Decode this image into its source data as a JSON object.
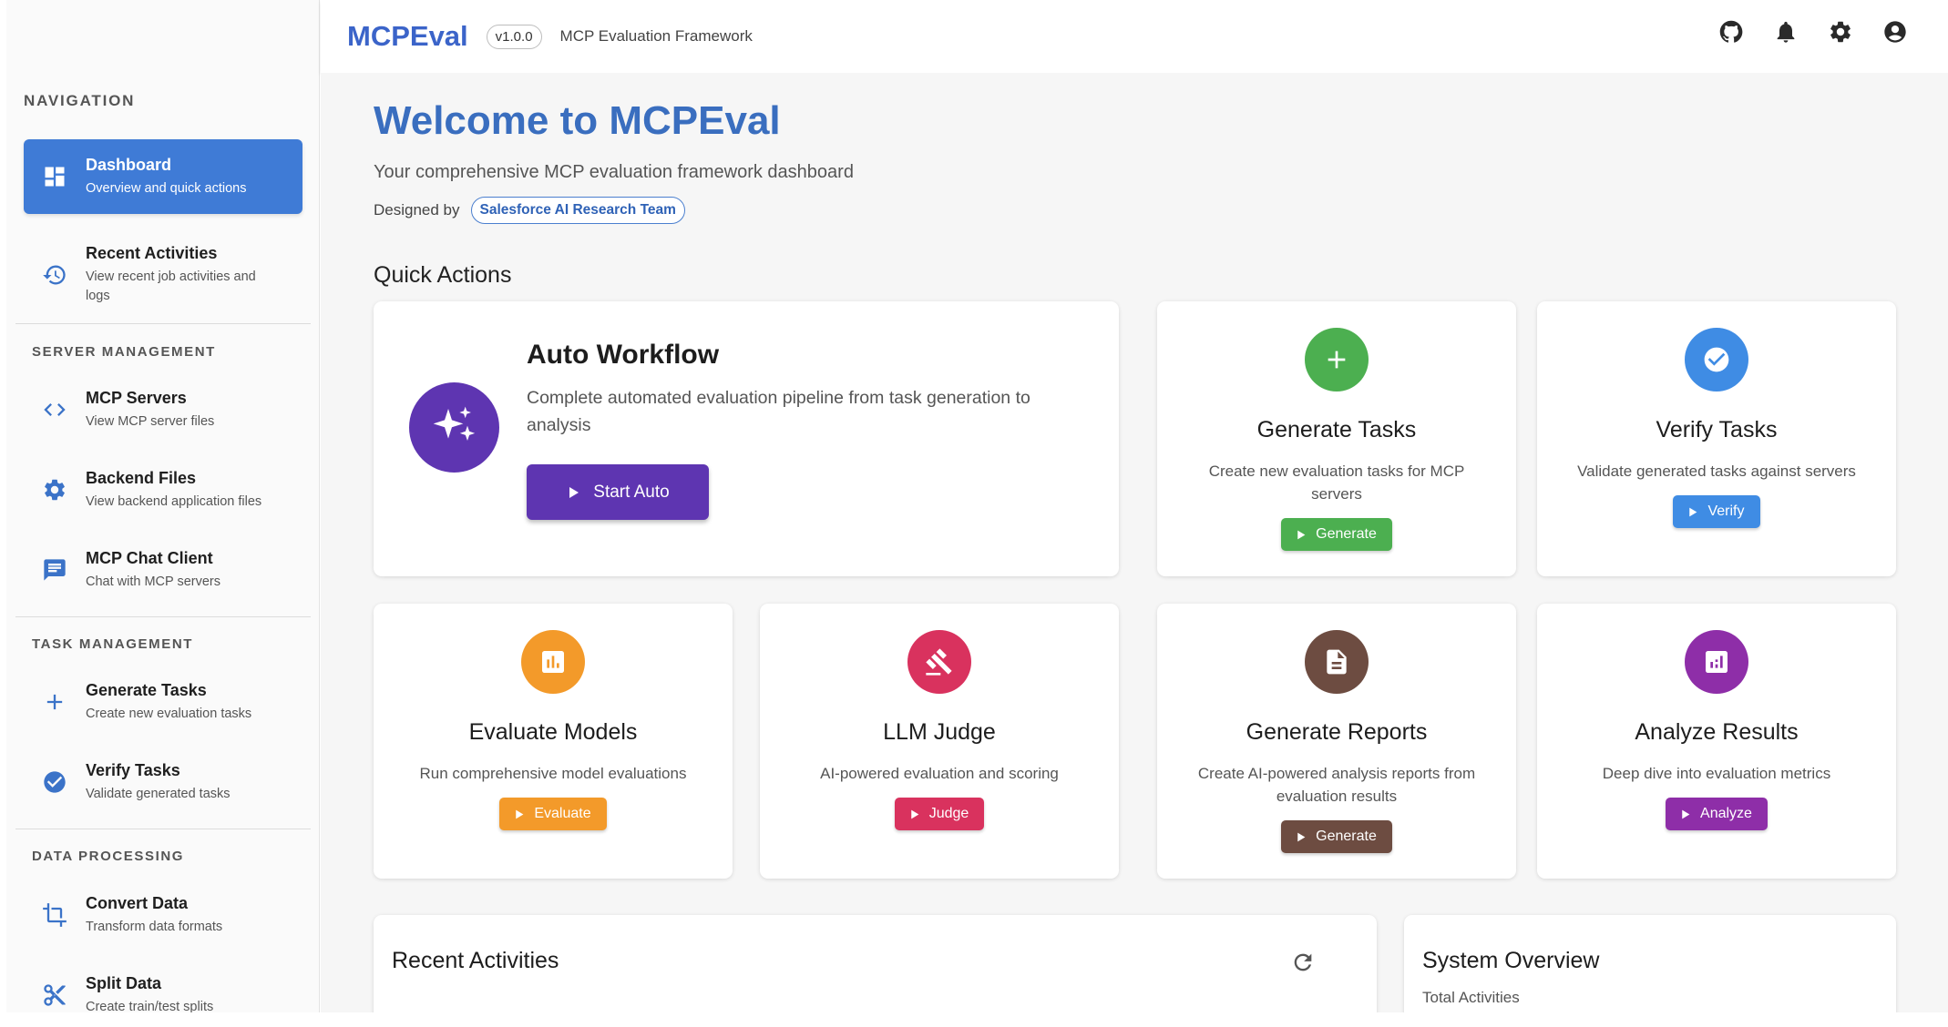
{
  "header": {
    "brand": "MCPEval",
    "version": "v1.0.0",
    "subtitle": "MCP Evaluation Framework",
    "icons": [
      "github-icon",
      "notifications-icon",
      "settings-icon",
      "account-icon"
    ]
  },
  "sidebar": {
    "heading": "NAVIGATION",
    "sections": {
      "server": "SERVER MANAGEMENT",
      "task": "TASK MANAGEMENT",
      "data": "DATA PROCESSING"
    },
    "items": [
      {
        "label": "Dashboard",
        "sub": "Overview and quick actions",
        "icon": "dashboard-icon"
      },
      {
        "label": "Recent Activities",
        "sub": "View recent job activities and logs",
        "icon": "history-icon"
      },
      {
        "label": "MCP Servers",
        "sub": "View MCP server files",
        "icon": "code-icon"
      },
      {
        "label": "Backend Files",
        "sub": "View backend application files",
        "icon": "gear-icon"
      },
      {
        "label": "MCP Chat Client",
        "sub": "Chat with MCP servers",
        "icon": "chat-icon"
      },
      {
        "label": "Generate Tasks",
        "sub": "Create new evaluation tasks",
        "icon": "plus-icon"
      },
      {
        "label": "Verify Tasks",
        "sub": "Validate generated tasks",
        "icon": "check-circle-icon"
      },
      {
        "label": "Convert Data",
        "sub": "Transform data formats",
        "icon": "crop-icon"
      },
      {
        "label": "Split Data",
        "sub": "Create train/test splits",
        "icon": "scissors-icon"
      }
    ]
  },
  "main": {
    "welcome": "Welcome to MCPEval",
    "subtitle": "Your comprehensive MCP evaluation framework dashboard",
    "designed_by": "Designed by",
    "team": "Salesforce AI Research Team",
    "quick_actions_title": "Quick Actions",
    "auto_workflow": {
      "title": "Auto Workflow",
      "desc": "Complete automated evaluation pipeline from task generation to analysis",
      "button": "Start Auto",
      "color": "#5e35b1"
    },
    "cards": [
      {
        "title": "Generate Tasks",
        "desc": "Create new evaluation tasks for MCP servers",
        "button": "Generate",
        "color": "#4caf50",
        "icon": "plus-icon"
      },
      {
        "title": "Verify Tasks",
        "desc": "Validate generated tasks against servers",
        "button": "Verify",
        "color": "#3f8ce4",
        "icon": "check-circle-icon"
      },
      {
        "title": "Evaluate Models",
        "desc": "Run comprehensive model evaluations",
        "button": "Evaluate",
        "color": "#f39a2a",
        "icon": "bar-chart-icon"
      },
      {
        "title": "LLM Judge",
        "desc": "AI-powered evaluation and scoring",
        "button": "Judge",
        "color": "#d9325e",
        "icon": "gavel-icon"
      },
      {
        "title": "Generate Reports",
        "desc": "Create AI-powered analysis reports from evaluation results",
        "button": "Generate",
        "color": "#6d4c41",
        "icon": "document-icon"
      },
      {
        "title": "Analyze Results",
        "desc": "Deep dive into evaluation metrics",
        "button": "Analyze",
        "color": "#8e2ea8",
        "icon": "analytics-icon"
      }
    ],
    "recent_activities": {
      "title": "Recent Activities"
    },
    "system_overview": {
      "title": "System Overview",
      "label": "Total Activities"
    }
  }
}
